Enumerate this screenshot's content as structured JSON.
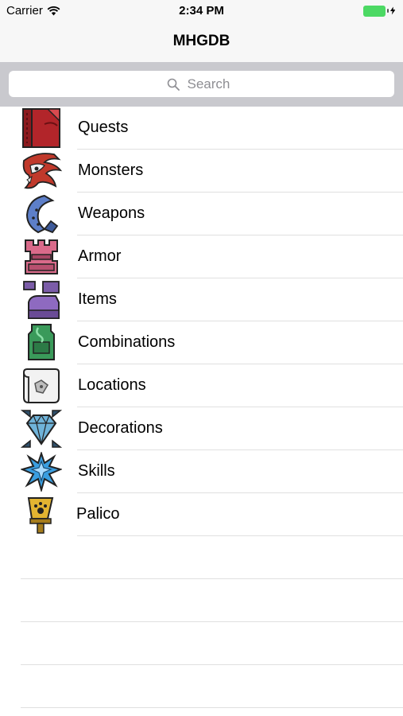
{
  "status": {
    "carrier": "Carrier",
    "time": "2:34 PM"
  },
  "nav": {
    "title": "MHGDB"
  },
  "search": {
    "placeholder": "Search"
  },
  "menu": [
    {
      "label": "Quests",
      "icon": "quest-scroll-icon"
    },
    {
      "label": "Monsters",
      "icon": "monster-icon"
    },
    {
      "label": "Weapons",
      "icon": "weapon-icon"
    },
    {
      "label": "Armor",
      "icon": "armor-icon"
    },
    {
      "label": "Items",
      "icon": "items-icon"
    },
    {
      "label": "Combinations",
      "icon": "potion-icon"
    },
    {
      "label": "Locations",
      "icon": "map-icon"
    },
    {
      "label": "Decorations",
      "icon": "gem-icon"
    },
    {
      "label": "Skills",
      "icon": "skill-crystal-icon"
    },
    {
      "label": "Palico",
      "icon": "palico-icon"
    }
  ],
  "colors": {
    "battery": "#4cd964",
    "search_bar_bg": "#c9c9ce",
    "nav_bg": "#f7f7f7"
  }
}
